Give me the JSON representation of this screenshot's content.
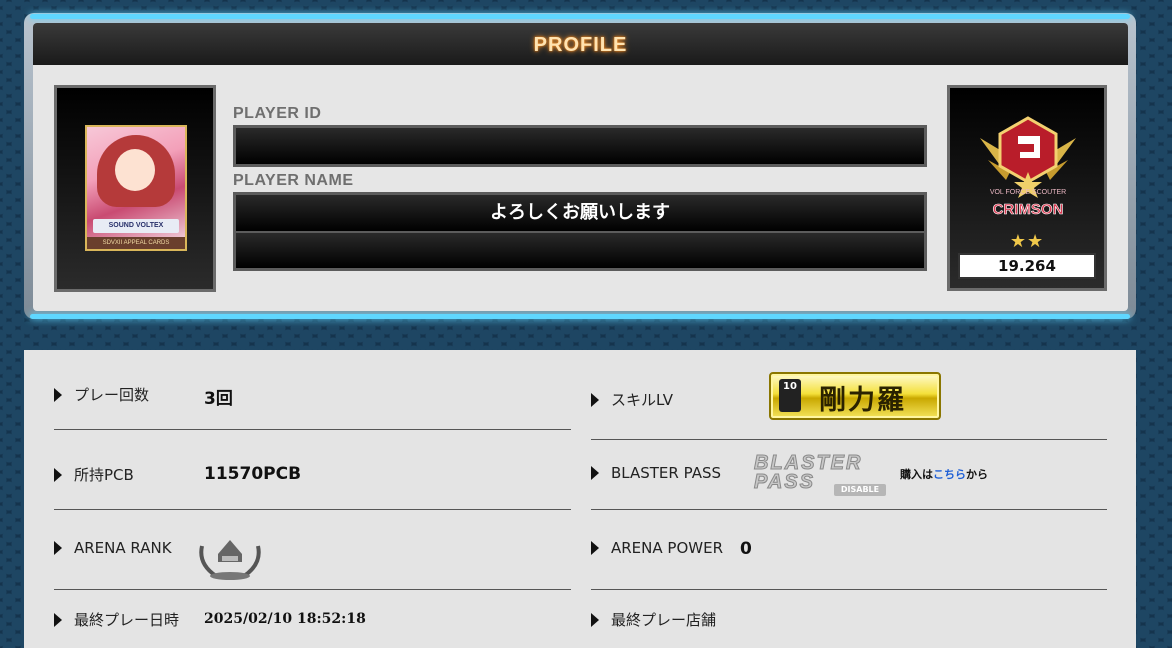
{
  "profile": {
    "title": "PROFILE",
    "card": {
      "logo_text": "SOUND VOLTEX",
      "footer_text": "SDVXII APPEAL CARDS"
    },
    "player_id_label": "PLAYER ID",
    "player_id_value": "",
    "player_name_label": "PLAYER NAME",
    "player_name_value": "よろしくお願いします",
    "player_comment_value": "",
    "volforce": {
      "class_name": "CRIMSON",
      "class_caption": "VOL FORCE SCOUTER",
      "stars": "★★",
      "value": "19.264"
    }
  },
  "stats": {
    "play_count_label": "プレー回数",
    "play_count_value": "3回",
    "pcb_label": "所持PCB",
    "pcb_value": "11570PCB",
    "arena_rank_label": "ARENA RANK",
    "last_play_label": "最終プレー日時",
    "last_play_value": "2025/02/10 18:52:18",
    "skill_label": "スキルLV",
    "skill_level": "10",
    "skill_name": "剛力羅",
    "blaster_pass_label": "BLASTER PASS",
    "blaster_logo": "BLASTER PASS",
    "blaster_status": "DISABLE",
    "blaster_buy_prefix": "購入は",
    "blaster_buy_link": "こちら",
    "blaster_buy_suffix": "から",
    "arena_power_label": "ARENA POWER",
    "arena_power_value": "0",
    "last_shop_label": "最終プレー店舗"
  },
  "colors": {
    "accent_glow": "#5fd7ff",
    "title_glow": "#ff9a2e",
    "link": "#1e5fd6",
    "skill_gold": "#f4e03a"
  }
}
